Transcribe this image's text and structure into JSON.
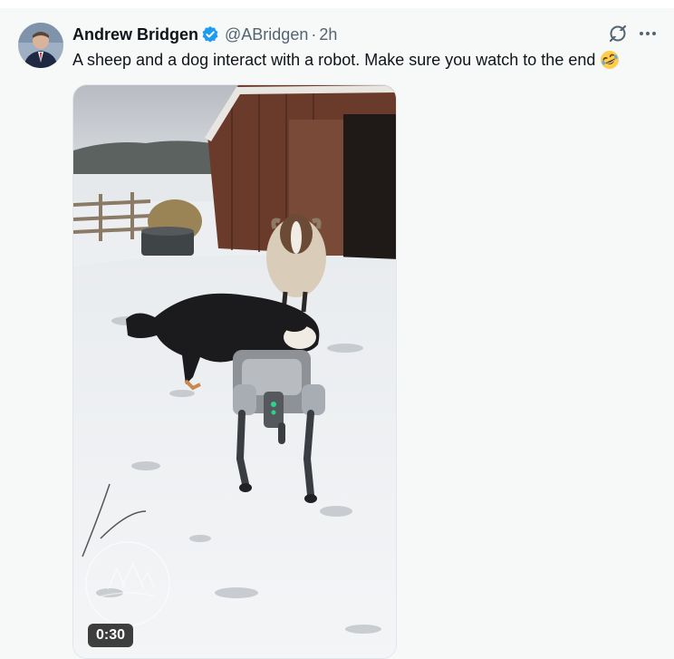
{
  "tweet": {
    "author": {
      "display_name": "Andrew Bridgen",
      "handle": "@ABridgen",
      "verified": true,
      "avatar_icon": "profile-photo"
    },
    "separator": "·",
    "time": "2h",
    "text": "A sheep and a dog interact with a robot. Make sure you watch to the end",
    "emoji_icon": "rolling-on-floor-laughing-emoji",
    "actions": {
      "grok_icon": "grok-icon",
      "more_icon": "more-options-icon"
    },
    "video": {
      "duration": "0:30",
      "description_icon": "video-thumbnail"
    }
  },
  "colors": {
    "background": "#f7f9f9",
    "text_primary": "#0f1419",
    "text_secondary": "#536471",
    "verified_blue": "#1d9bf0"
  }
}
